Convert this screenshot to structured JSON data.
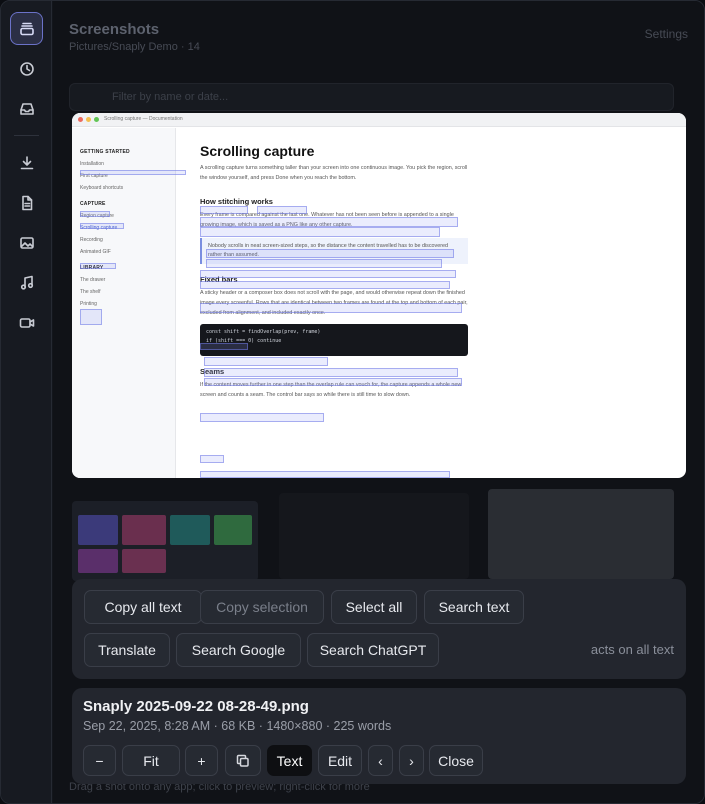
{
  "backdrop": {
    "title": "Screenshots",
    "subtitle": "Pictures/Snaply Demo · 14",
    "settings_label": "Settings",
    "search_placeholder": "Filter by name or date...",
    "hint": "Drag a shot onto any app; click to preview; right-click for more"
  },
  "sidebar": {
    "items": [
      {
        "icon": "library-icon",
        "active": true
      },
      {
        "icon": "clock-icon",
        "active": false
      },
      {
        "icon": "inbox-icon",
        "active": false
      },
      {
        "icon": "download-icon",
        "active": false
      },
      {
        "icon": "document-icon",
        "active": false
      },
      {
        "icon": "image-icon",
        "active": false
      },
      {
        "icon": "music-icon",
        "active": false
      },
      {
        "icon": "video-icon",
        "active": false
      }
    ]
  },
  "preview": {
    "window_title": "Scrolling capture — Documentation",
    "nav": {
      "getting_started": "GETTING STARTED",
      "installation": "Installation",
      "first_capture": "First capture",
      "keyboard_shortcuts": "Keyboard shortcuts",
      "capture": "CAPTURE",
      "region_capture": "Region capture",
      "scrolling_capture": "Scrolling capture",
      "recording": "Recording",
      "animated_gif": "Animated GIF",
      "library": "LIBRARY",
      "the_drawer": "The drawer",
      "the_shelf": "The shelf",
      "printing": "Printing"
    },
    "doc": {
      "heading": "Scrolling capture",
      "intro": "A scrolling capture turns something taller than your screen into one continuous image. You pick the region, scroll the window yourself, and press Done when you reach the bottom.",
      "h_stitching": "How stitching works",
      "p_stitching": "Every frame is compared against the last one. Whatever has not been seen before is appended to a single growing image, which is saved as a PNG like any other capture.",
      "note": "Nobody scrolls in neat screen-sized steps, so the distance the content travelled has to be discovered rather than assumed.",
      "h_fixed": "Fixed bars",
      "p_fixed": "A sticky header or a composer box does not scroll with the page, and would otherwise repeat down the finished image every screenful. Rows that are identical between two frames are found at the top and bottom of each pair, excluded from alignment, and included exactly once.",
      "code_1": "const shift = findOverlap(prev, frame)",
      "code_2": "if (shift === 0) continue",
      "h_seams": "Seams",
      "p_seams": "If the content moves further in one step than the overlap rule can vouch for, the capture appends a whole new screen and counts a seam. The control bar says so while there is still time to slow down."
    }
  },
  "actions": {
    "copy_all_text": "Copy all text",
    "copy_selection": "Copy selection",
    "select_all": "Select all",
    "search_text": "Search text",
    "translate": "Translate",
    "search_google": "Search Google",
    "search_chatgpt": "Search ChatGPT",
    "hint": "acts on all text"
  },
  "info": {
    "filename": "Snaply 2025-09-22 08-28-49.png",
    "meta": "Sep 22, 2025, 8:28 AM · 68 KB · 1480×880 · 225 words",
    "zoom_out": "−",
    "fit": "Fit",
    "zoom_in": "+",
    "copy_icon": "copy-icon",
    "text": "Text",
    "edit": "Edit",
    "prev": "‹",
    "next": "›",
    "close": "Close"
  },
  "colors": {
    "accent": "#6b72c8",
    "panel": "#23262e",
    "active_button": "#0e0f12",
    "ocr_highlight": "#8c96f5"
  }
}
